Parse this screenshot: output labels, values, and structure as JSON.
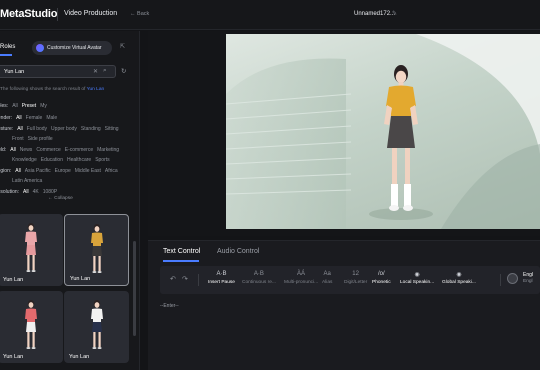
{
  "header": {
    "logo": "MetaStudio",
    "product": "Video Production",
    "back": "←  Back",
    "project_title": "Unnamed172...",
    "edit_icon": "pencil-icon"
  },
  "left_panel": {
    "tab_roles": "Roles",
    "custom_button": "Customize Virtual Avatar",
    "search_value": "Yun Lan",
    "result_prefix": "The following shows the search result of",
    "result_term": "Yun Lan",
    "filters": [
      {
        "label": "Roles:",
        "options": [
          "All",
          "Preset",
          "My"
        ],
        "selected": "Preset"
      },
      {
        "label": "Gender:",
        "options": [
          "All",
          "Female",
          "Male"
        ],
        "selected": "All"
      },
      {
        "label": "Gesture:",
        "options": [
          "All",
          "Full body",
          "Upper body",
          "Standing",
          "Sitting"
        ],
        "selected": "All"
      },
      {
        "label": "",
        "options": [
          "Front",
          "Side profile"
        ],
        "selected": ""
      },
      {
        "label": "Field:",
        "options": [
          "All",
          "News",
          "Commerce",
          "E-commerce",
          "Marketing"
        ],
        "selected": "All"
      },
      {
        "label": "",
        "options": [
          "Knowledge",
          "Education",
          "Healthcare",
          "Sports"
        ],
        "selected": ""
      },
      {
        "label": "Region:",
        "options": [
          "All",
          "Asia Pacific",
          "Europe",
          "Middle East",
          "Africa"
        ],
        "selected": "All"
      },
      {
        "label": "",
        "options": [
          "Latin America"
        ],
        "selected": ""
      },
      {
        "label": "Resolution:",
        "options": [
          "All",
          "4K",
          "1080P"
        ],
        "selected": "All"
      }
    ],
    "collapse": "← Collapse",
    "cards": [
      {
        "name": "Yun Lan",
        "shirt": "#e9a6a9",
        "bottom": "#e59a9d",
        "active": false
      },
      {
        "name": "Yun Lan",
        "shirt": "#d9a43b",
        "bottom": "#3a3838",
        "active": true
      },
      {
        "name": "Yun Lan",
        "shirt": "#e36a6d",
        "bottom": "#f0f0f0",
        "active": false
      },
      {
        "name": "Yun Lan",
        "shirt": "#f2f2f2",
        "bottom": "#27304a",
        "active": false
      }
    ]
  },
  "preview": {
    "shirt": "#e3a92f",
    "skirt": "#4a4748"
  },
  "control": {
    "tab_text": "Text Control",
    "tab_audio": "Audio Control",
    "tools": [
      {
        "icon": "A·B",
        "label": "Insert Pause",
        "on": true
      },
      {
        "icon": "A·B",
        "label": "Continuous re...",
        "on": false
      },
      {
        "icon": "ÀÁ",
        "label": "Multi-pronunci...",
        "on": false
      },
      {
        "icon": "Aa",
        "label": "Alias",
        "on": false
      },
      {
        "icon": "12",
        "label": "Digit/Letter",
        "on": false
      },
      {
        "icon": "/o/",
        "label": "Phonetic",
        "on": true
      },
      {
        "icon": "◉",
        "label": "Local Speakin...",
        "on": true
      },
      {
        "icon": "◉",
        "label": "Global Speaki...",
        "on": true
      }
    ],
    "lang_line1": "Engl",
    "lang_line2": "Engl",
    "editor_placeholder": "--Enter--"
  }
}
